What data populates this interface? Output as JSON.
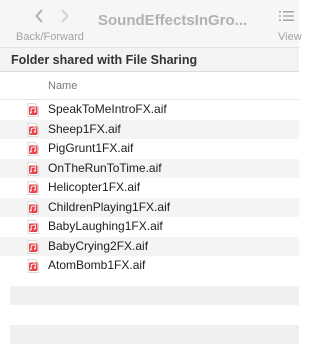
{
  "toolbar": {
    "nav_label": "Back/Forward",
    "title": "SoundEffectsInGro...",
    "view_label": "View",
    "back_icon": "chevron-left-icon",
    "forward_icon": "chevron-right-icon",
    "view_icon": "list-view-icon"
  },
  "path_bar": {
    "title": "Folder shared with File Sharing"
  },
  "columns": {
    "name": "Name"
  },
  "files": [
    {
      "name": "SpeakToMeIntroFX.aif",
      "icon": "aif-audio-file-icon"
    },
    {
      "name": "Sheep1FX.aif",
      "icon": "aif-audio-file-icon"
    },
    {
      "name": "PigGrunt1FX.aif",
      "icon": "aif-audio-file-icon"
    },
    {
      "name": "OnTheRunToTime.aif",
      "icon": "aif-audio-file-icon"
    },
    {
      "name": "Helicopter1FX.aif",
      "icon": "aif-audio-file-icon"
    },
    {
      "name": "ChildrenPlaying1FX.aif",
      "icon": "aif-audio-file-icon"
    },
    {
      "name": "BabyLaughing1FX.aif",
      "icon": "aif-audio-file-icon"
    },
    {
      "name": "BabyCrying2FX.aif",
      "icon": "aif-audio-file-icon"
    },
    {
      "name": "AtomBomb1FX.aif",
      "icon": "aif-audio-file-icon"
    }
  ],
  "colors": {
    "file_icon_red": "#e8434b",
    "toolbar_bg": "#f6f6f6",
    "stripe": "#f4f4f4"
  }
}
